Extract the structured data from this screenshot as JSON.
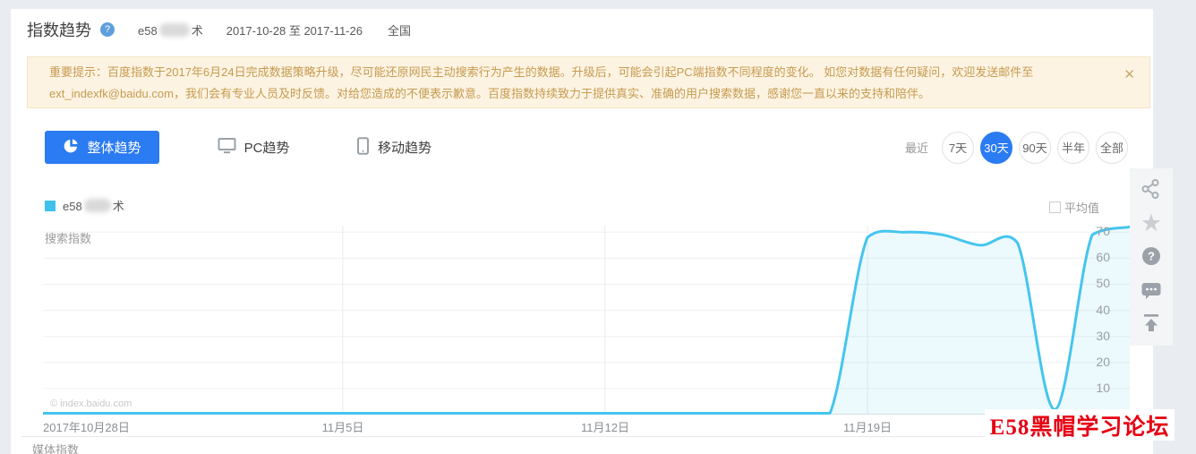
{
  "header": {
    "title": "指数趋势",
    "help_icon": "?",
    "keyword_prefix": "e58",
    "keyword_suffix": "术",
    "date_range": "2017-10-28 至 2017-11-26",
    "region": "全国"
  },
  "banner": {
    "text": "重要提示：百度指数于2017年6月24日完成数据策略升级，尽可能还原网民主动搜索行为产生的数据。升级后，可能会引起PC端指数不同程度的变化。 如您对数据有任何疑问，欢迎发送邮件至ext_indexfk@baidu.com，我们会有专业人员及时反馈。对给您造成的不便表示歉意。百度指数持续致力于提供真实、准确的用户搜索数据，感谢您一直以来的支持和陪伴。",
    "close_label": "✕"
  },
  "tabs": [
    {
      "label": "整体趋势",
      "active": true
    },
    {
      "label": "PC趋势",
      "active": false
    },
    {
      "label": "移动趋势",
      "active": false
    }
  ],
  "time_filter": {
    "label": "最近",
    "options": [
      {
        "label": "7天",
        "active": false
      },
      {
        "label": "30天",
        "active": true
      },
      {
        "label": "90天",
        "active": false
      },
      {
        "label": "半年",
        "active": false
      },
      {
        "label": "全部",
        "active": false
      }
    ]
  },
  "legend": {
    "keyword_prefix": "e58",
    "keyword_suffix": "术",
    "average_label": "平均值"
  },
  "chart_data": {
    "type": "line",
    "title": "搜索指数",
    "series": [
      {
        "name": "e58██术",
        "color": "#45c5ee",
        "values": [
          0,
          0,
          0,
          0,
          0,
          0,
          0,
          0,
          0,
          0,
          0,
          0,
          0,
          0,
          0,
          0,
          0,
          0,
          0,
          0,
          0,
          0,
          68,
          70,
          69,
          65,
          66,
          2,
          69,
          73
        ]
      }
    ],
    "x_start_date": "2017-10-28",
    "x_end_date": "2017-11-26",
    "x_tick_labels": [
      "2017年10月28日",
      "11月5日",
      "11月12日",
      "11月19日"
    ],
    "x_tick_days": [
      0,
      8,
      15,
      22
    ],
    "y_ticks": [
      10,
      20,
      30,
      40,
      50,
      60,
      70
    ],
    "ylim": [
      0,
      72.5
    ],
    "grid": true,
    "legend_position": "top-left",
    "area_fill": "rgba(69,197,238,0.10)"
  },
  "chart_copyright": "© index.baidu.com",
  "media_section_label": "媒体指数",
  "overlay_watermark": "E58黑帽学习论坛",
  "toolbar_icons": [
    "share-icon",
    "favorite-star-icon",
    "help-icon",
    "feedback-icon",
    "back-to-top-icon"
  ],
  "colors": {
    "accent_blue": "#2b7bf2",
    "line_cyan": "#45c5ee",
    "legend_swatch": "#3fc1ec",
    "banner_bg": "#fdf3e2",
    "banner_text": "#c59b50",
    "watermark_red": "#e60012",
    "page_bg": "#e9edf1"
  }
}
